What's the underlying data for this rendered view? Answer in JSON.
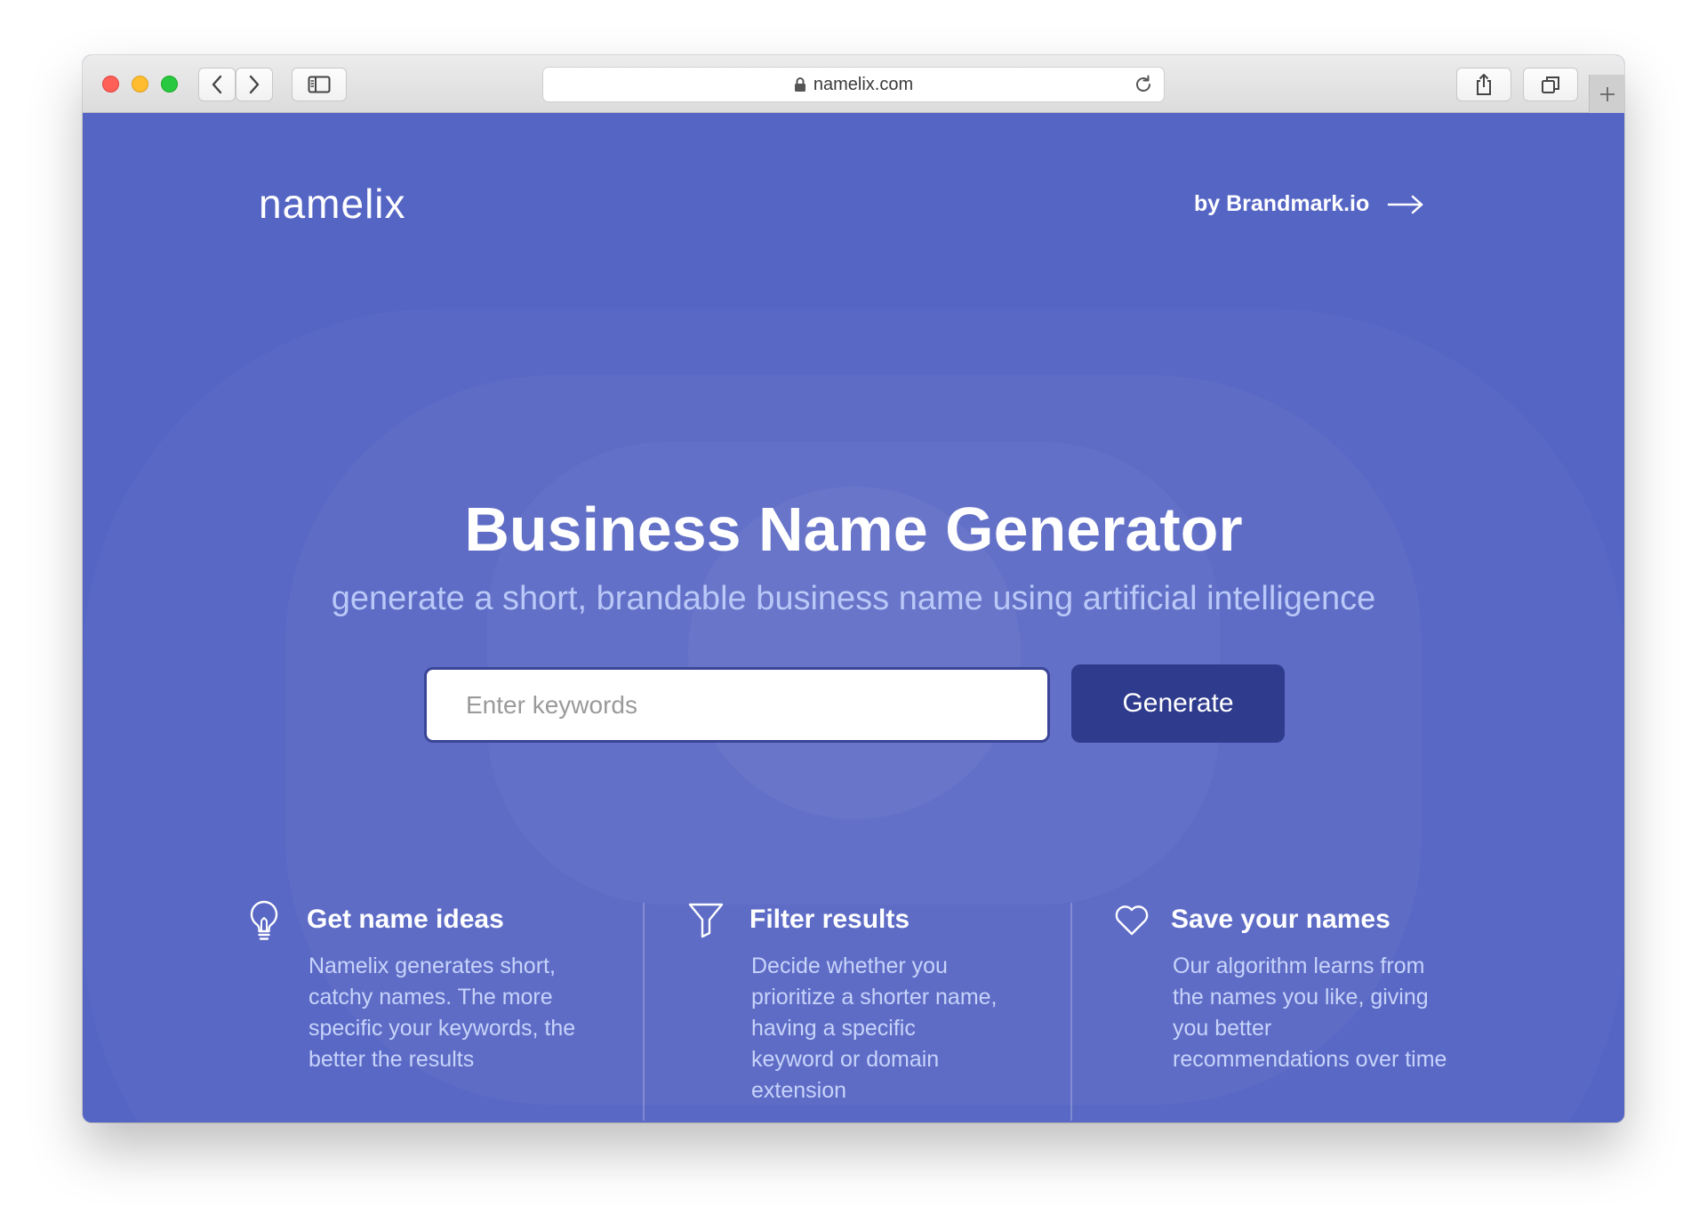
{
  "browser": {
    "url": "namelix.com",
    "colors": {
      "red": "#fe5f57",
      "yellow": "#febc2e",
      "green": "#28c840"
    }
  },
  "header": {
    "logo": "namelix",
    "by_link": "by Brandmark.io"
  },
  "hero": {
    "title": "Business Name Generator",
    "subtitle": "generate a short, brandable business name using artificial intelligence",
    "input_placeholder": "Enter keywords",
    "input_value": "",
    "generate_label": "Generate"
  },
  "features": [
    {
      "icon": "lightbulb-icon",
      "title": "Get name ideas",
      "lines": [
        "Namelix generates short,",
        "catchy names. The more",
        "specific your keywords, the",
        "better the results"
      ]
    },
    {
      "icon": "filter-icon",
      "title": "Filter results",
      "lines": [
        "Decide whether you",
        "prioritize a shorter name,",
        "having a specific",
        "keyword or domain",
        "extension"
      ]
    },
    {
      "icon": "heart-icon",
      "title": "Save your names",
      "lines": [
        "Our algorithm learns from",
        "the names you like, giving",
        "you better",
        "recommendations over time"
      ]
    }
  ],
  "colors": {
    "background": "#5565c4",
    "subtitle": "#b9c8f7",
    "button": "#2f3b8c",
    "feature_text": "#c7d3fa"
  }
}
